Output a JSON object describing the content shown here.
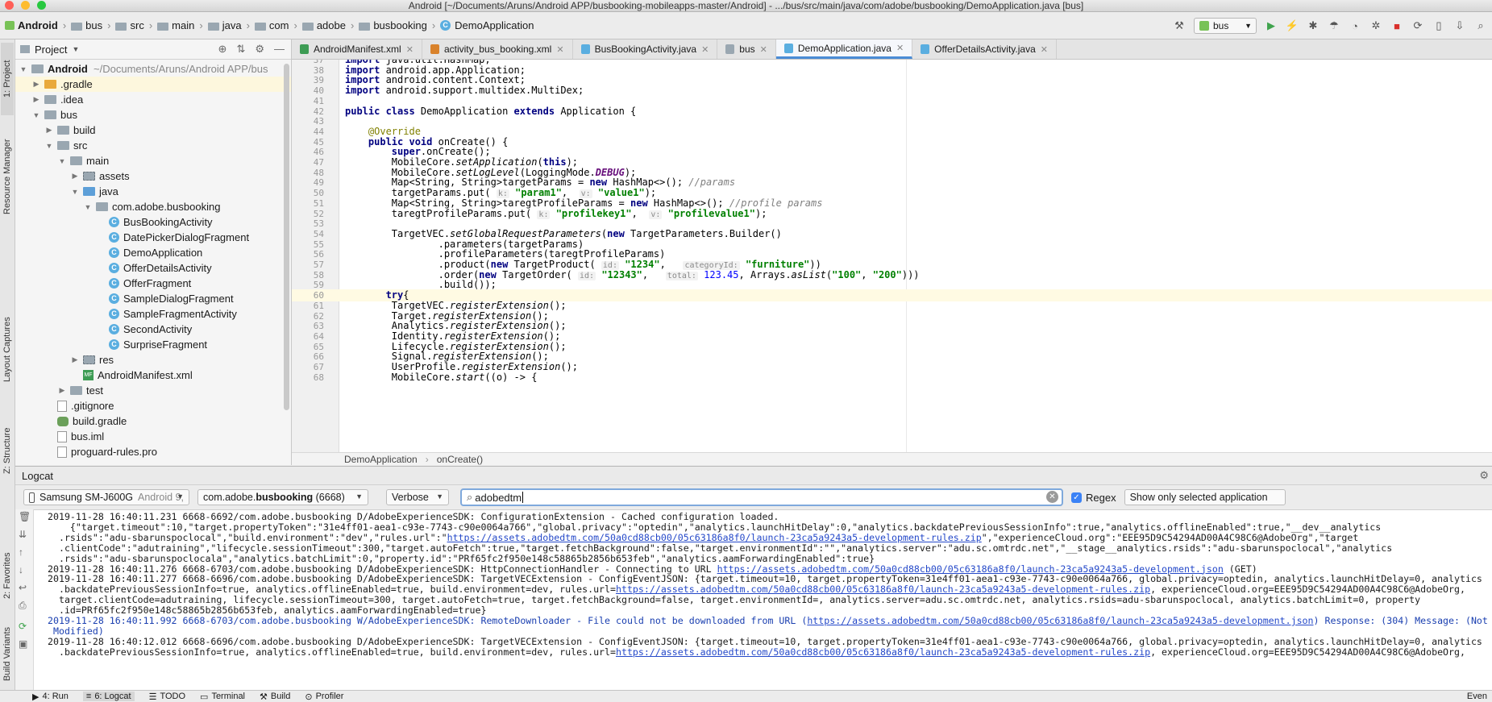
{
  "window": {
    "title": "Android [~/Documents/Aruns/Android APP/busbooking-mobileapps-master/Android] - .../bus/src/main/java/com/adobe/busbooking/DemoApplication.java [bus]"
  },
  "navbar": {
    "crumbs": [
      "Android",
      "bus",
      "src",
      "main",
      "java",
      "com",
      "adobe",
      "busbooking",
      "DemoApplication"
    ],
    "run_config": "bus"
  },
  "left_strip": {
    "project": "1: Project",
    "resource_manager": "Resource Manager",
    "layout_captures": "Layout Captures",
    "structure": "Z: Structure",
    "favorites": "2: Favorites",
    "build_variants": "Build Variants"
  },
  "project": {
    "header": "Project",
    "tree": [
      {
        "label": "Android",
        "extra": "~/Documents/Aruns/Android APP/bus",
        "depth": 0,
        "arrow": "open",
        "icon": "folder"
      },
      {
        "label": ".gradle",
        "depth": 1,
        "arrow": "closed",
        "icon": "folder-orange",
        "selected": true
      },
      {
        "label": ".idea",
        "depth": 1,
        "arrow": "closed",
        "icon": "folder"
      },
      {
        "label": "bus",
        "depth": 1,
        "arrow": "open",
        "icon": "folder"
      },
      {
        "label": "build",
        "depth": 2,
        "arrow": "closed",
        "icon": "folder"
      },
      {
        "label": "src",
        "depth": 2,
        "arrow": "open",
        "icon": "folder"
      },
      {
        "label": "main",
        "depth": 3,
        "arrow": "open",
        "icon": "folder"
      },
      {
        "label": "assets",
        "depth": 4,
        "arrow": "closed",
        "icon": "pkg"
      },
      {
        "label": "java",
        "depth": 4,
        "arrow": "open",
        "icon": "folder-blue"
      },
      {
        "label": "com.adobe.busbooking",
        "depth": 5,
        "arrow": "open",
        "icon": "folder"
      },
      {
        "label": "BusBookingActivity",
        "depth": 6,
        "arrow": "",
        "icon": "cls"
      },
      {
        "label": "DatePickerDialogFragment",
        "depth": 6,
        "arrow": "",
        "icon": "cls"
      },
      {
        "label": "DemoApplication",
        "depth": 6,
        "arrow": "",
        "icon": "cls"
      },
      {
        "label": "OfferDetailsActivity",
        "depth": 6,
        "arrow": "",
        "icon": "cls"
      },
      {
        "label": "OfferFragment",
        "depth": 6,
        "arrow": "",
        "icon": "cls"
      },
      {
        "label": "SampleDialogFragment",
        "depth": 6,
        "arrow": "",
        "icon": "cls"
      },
      {
        "label": "SampleFragmentActivity",
        "depth": 6,
        "arrow": "",
        "icon": "cls"
      },
      {
        "label": "SecondActivity",
        "depth": 6,
        "arrow": "",
        "icon": "cls"
      },
      {
        "label": "SurpriseFragment",
        "depth": 6,
        "arrow": "",
        "icon": "cls"
      },
      {
        "label": "res",
        "depth": 4,
        "arrow": "closed",
        "icon": "pkg"
      },
      {
        "label": "AndroidManifest.xml",
        "depth": 4,
        "arrow": "",
        "icon": "mf"
      },
      {
        "label": "test",
        "depth": 3,
        "arrow": "closed",
        "icon": "folder"
      },
      {
        "label": ".gitignore",
        "depth": 2,
        "arrow": "",
        "icon": "file"
      },
      {
        "label": "build.gradle",
        "depth": 2,
        "arrow": "",
        "icon": "gradle"
      },
      {
        "label": "bus.iml",
        "depth": 2,
        "arrow": "",
        "icon": "file"
      },
      {
        "label": "proguard-rules.pro",
        "depth": 2,
        "arrow": "",
        "icon": "file"
      }
    ]
  },
  "tabs": [
    {
      "label": "AndroidManifest.xml",
      "color": "#3d9c54",
      "active": false
    },
    {
      "label": "activity_bus_booking.xml",
      "color": "#d9822b",
      "active": false
    },
    {
      "label": "BusBookingActivity.java",
      "color": "#5aaee0",
      "active": false
    },
    {
      "label": "bus",
      "color": "#9aa7b1",
      "active": false
    },
    {
      "label": "DemoApplication.java",
      "color": "#5aaee0",
      "active": true
    },
    {
      "label": "OfferDetailsActivity.java",
      "color": "#5aaee0",
      "active": false
    }
  ],
  "editor": {
    "highlight_line": 60,
    "lines": [
      {
        "n": "37",
        "html": "<span class=\"kw\">import</span> java.util.HashMap;"
      },
      {
        "n": "38",
        "html": "<span class=\"kw\">import</span> android.app.Application;"
      },
      {
        "n": "39",
        "html": "<span class=\"kw\">import</span> android.content.Context;"
      },
      {
        "n": "40",
        "html": "<span class=\"kw\">import</span> android.support.multidex.MultiDex;"
      },
      {
        "n": "41",
        "html": ""
      },
      {
        "n": "42",
        "html": "<span class=\"kw\">public class</span> DemoApplication <span class=\"kw\">extends</span> Application {"
      },
      {
        "n": "43",
        "html": ""
      },
      {
        "n": "44",
        "html": "    <span class=\"ann\">@Override</span>"
      },
      {
        "n": "45",
        "html": "    <span class=\"kw\">public void</span> onCreate() {"
      },
      {
        "n": "46",
        "html": "        <span class=\"kw\">super</span>.onCreate();"
      },
      {
        "n": "47",
        "html": "        MobileCore.<span class=\"it\">setApplication</span>(<span class=\"kw\">this</span>);"
      },
      {
        "n": "48",
        "html": "        MobileCore.<span class=\"it\">setLogLevel</span>(LoggingMode.<span class=\"itbold\">DEBUG</span>);"
      },
      {
        "n": "49",
        "html": "        Map&lt;String, String&gt;targetParams = <span class=\"kw\">new</span> HashMap&lt;&gt;(); <span class=\"cm\">//params</span>"
      },
      {
        "n": "50",
        "html": "        targetParams.put( <span class=\"hint\">k:</span> <span class=\"str\">\"param1\"</span>,  <span class=\"hint\">v:</span> <span class=\"str\">\"value1\"</span>);"
      },
      {
        "n": "51",
        "html": "        Map&lt;String, String&gt;taregtProfileParams = <span class=\"kw\">new</span> HashMap&lt;&gt;(); <span class=\"cm\">//profile params</span>"
      },
      {
        "n": "52",
        "html": "        taregtProfileParams.put( <span class=\"hint\">k:</span> <span class=\"str\">\"profilekey1\"</span>,  <span class=\"hint\">v:</span> <span class=\"str\">\"profilevalue1\"</span>);"
      },
      {
        "n": "53",
        "html": ""
      },
      {
        "n": "54",
        "html": "        TargetVEC.<span class=\"it\">setGlobalRequestParameters</span>(<span class=\"kw\">new</span> TargetParameters.Builder()"
      },
      {
        "n": "55",
        "html": "                .parameters(targetParams)"
      },
      {
        "n": "56",
        "html": "                .profileParameters(taregtProfileParams)"
      },
      {
        "n": "57",
        "html": "                .product(<span class=\"kw\">new</span> TargetProduct( <span class=\"hint\">id:</span> <span class=\"str\">\"1234\"</span>,   <span class=\"hint\">categoryId:</span> <span class=\"str\">\"furniture\"</span>))"
      },
      {
        "n": "58",
        "html": "                .order(<span class=\"kw\">new</span> TargetOrder( <span class=\"hint\">id:</span> <span class=\"str\">\"12343\"</span>,   <span class=\"hint\">total:</span> <span class=\"num\">123.45</span>, Arrays.<span class=\"it\">asList</span>(<span class=\"str\">\"100\"</span>, <span class=\"str\">\"200\"</span>)))"
      },
      {
        "n": "59",
        "html": "                .build());"
      },
      {
        "n": "60",
        "html": "       <span class=\"kw\">try</span>{"
      },
      {
        "n": "61",
        "html": "        TargetVEC.<span class=\"it\">registerExtension</span>();"
      },
      {
        "n": "62",
        "html": "        Target.<span class=\"it\">registerExtension</span>();"
      },
      {
        "n": "63",
        "html": "        Analytics.<span class=\"it\">registerExtension</span>();"
      },
      {
        "n": "64",
        "html": "        Identity.<span class=\"it\">registerExtension</span>();"
      },
      {
        "n": "65",
        "html": "        Lifecycle.<span class=\"it\">registerExtension</span>();"
      },
      {
        "n": "66",
        "html": "        Signal.<span class=\"it\">registerExtension</span>();"
      },
      {
        "n": "67",
        "html": "        UserProfile.<span class=\"it\">registerExtension</span>();"
      },
      {
        "n": "68",
        "html": "        MobileCore.<span class=\"it\">start</span>((o) -&gt; {"
      }
    ]
  },
  "editor_breadcrumb": [
    "DemoApplication",
    "onCreate()"
  ],
  "logcat": {
    "title": "Logcat",
    "device": "Samsung SM-J600G",
    "device_os": "Android 9,",
    "process_prefix": "com.adobe.",
    "process_bold": "busbooking",
    "process_suffix": " (6668)",
    "level": "Verbose",
    "search_value": "adobedtm",
    "regex_label": "Regex",
    "filter_option": "Show only selected application",
    "lines": [
      {
        "t": "2019-11-28 16:40:11.231 6668-6692/com.adobe.busbooking D/AdobeExperienceSDK: ConfigurationExtension - Cached configuration loaded."
      },
      {
        "t": "    {\"target.timeout\":10,\"target.propertyToken\":\"31e4ff01-aea1-c93e-7743-c90e0064a766\",\"global.privacy\":\"optedin\",\"analytics.launchHitDelay\":0,\"analytics.backdatePreviousSessionInfo\":true,\"analytics.offlineEnabled\":true,\"__dev__analytics"
      },
      {
        "t": "  .rsids\":\"adu-sbarunspoclocal\",\"build.environment\":\"dev\",\"rules.url\":\"",
        "link": "https://assets.adobedtm.com/50a0cd88cb00/05c63186a8f0/launch-23ca5a9243a5-development-rules.zip",
        "t2": "\",\"experienceCloud.org\":\"EEE95D9C54294AD00A4C98C6@AdobeOrg\",\"target"
      },
      {
        "t": "  .clientCode\":\"adutraining\",\"lifecycle.sessionTimeout\":300,\"target.autoFetch\":true,\"target.fetchBackground\":false,\"target.environmentId\":\"\",\"analytics.server\":\"adu.sc.omtrdc.net\",\"__stage__analytics.rsids\":\"adu-sbarunspoclocal\",\"analytics"
      },
      {
        "t": "  .rsids\":\"adu-sbarunspoclocala\",\"analytics.batchLimit\":0,\"property.id\":\"PRf65fc2f950e148c58865b2856b653feb\",\"analytics.aamForwardingEnabled\":true}"
      },
      {
        "t": "2019-11-28 16:40:11.276 6668-6703/com.adobe.busbooking D/AdobeExperienceSDK: HttpConnectionHandler - Connecting to URL ",
        "link": "https://assets.adobedtm.com/50a0cd88cb00/05c63186a8f0/launch-23ca5a9243a5-development.json",
        "t2": " (GET)"
      },
      {
        "t": "2019-11-28 16:40:11.277 6668-6696/com.adobe.busbooking D/AdobeExperienceSDK: TargetVECExtension - ConfigEventJSON: {target.timeout=10, target.propertyToken=31e4ff01-aea1-c93e-7743-c90e0064a766, global.privacy=optedin, analytics.launchHitDelay=0, analytics"
      },
      {
        "t": "  .backdatePreviousSessionInfo=true, analytics.offlineEnabled=true, build.environment=dev, rules.url=",
        "link": "https://assets.adobedtm.com/50a0cd88cb00/05c63186a8f0/launch-23ca5a9243a5-development-rules.zip",
        "t2": ", experienceCloud.org=EEE95D9C54294AD00A4C98C6@AdobeOrg,"
      },
      {
        "t": "  target.clientCode=adutraining, lifecycle.sessionTimeout=300, target.autoFetch=true, target.fetchBackground=false, target.environmentId=, analytics.server=adu.sc.omtrdc.net, analytics.rsids=adu-sbarunspoclocal, analytics.batchLimit=0, property"
      },
      {
        "t": "  .id=PRf65fc2f950e148c58865b2856b653feb, analytics.aamForwardingEnabled=true}"
      },
      {
        "t": "2019-11-28 16:40:11.992 6668-6703/com.adobe.busbooking W/AdobeExperienceSDK: RemoteDownloader - File could not be downloaded from URL (",
        "link": "https://assets.adobedtm.com/50a0cd88cb00/05c63186a8f0/launch-23ca5a9243a5-development.json",
        "t2": ") Response: (304) Message: (Not",
        "warn": true
      },
      {
        "t": " Modified)",
        "warn": true
      },
      {
        "t": "2019-11-28 16:40:12.012 6668-6696/com.adobe.busbooking D/AdobeExperienceSDK: TargetVECExtension - ConfigEventJSON: {target.timeout=10, target.propertyToken=31e4ff01-aea1-c93e-7743-c90e0064a766, global.privacy=optedin, analytics.launchHitDelay=0, analytics"
      },
      {
        "t": "  .backdatePreviousSessionInfo=true, analytics.offlineEnabled=true, build.environment=dev, rules.url=",
        "link": "https://assets.adobedtm.com/50a0cd88cb00/05c63186a8f0/launch-23ca5a9243a5-development-rules.zip",
        "t2": ", experienceCloud.org=EEE95D9C54294AD00A4C98C6@AdobeOrg,"
      }
    ]
  },
  "bottombar": {
    "items": [
      {
        "label": "4: Run",
        "icon": "▶",
        "active": false
      },
      {
        "label": "6: Logcat",
        "icon": "≡",
        "active": true
      },
      {
        "label": "TODO",
        "icon": "☰",
        "active": false
      },
      {
        "label": "Terminal",
        "icon": "▭",
        "active": false
      },
      {
        "label": "Build",
        "icon": "⚒",
        "active": false
      },
      {
        "label": "Profiler",
        "icon": "⊙",
        "active": false
      }
    ],
    "right": "Even"
  }
}
